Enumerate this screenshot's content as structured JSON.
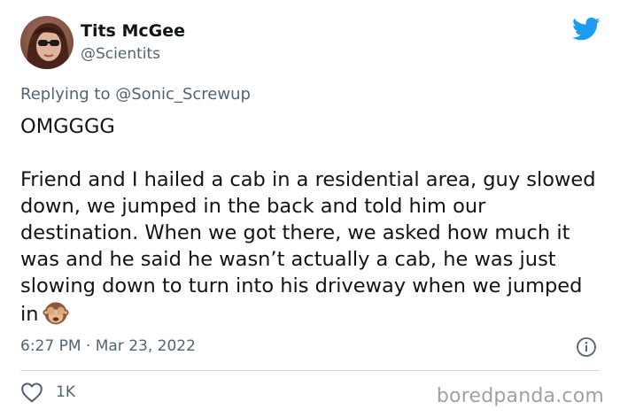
{
  "author": {
    "display_name": "Tits McGee",
    "handle": "@Scientits",
    "avatar_icon": "profile-photo-avatar"
  },
  "brand": {
    "icon": "twitter-bird-icon",
    "color": "#1d9bf0"
  },
  "reply": {
    "prefix": "Replying to ",
    "mention": "@Sonic_Screwup"
  },
  "tweet": {
    "line1": "OMGGGG",
    "line2": "Friend and I hailed a cab in a residential area, guy slowed down, we jumped in the back and told him our destination. When we got there, we asked how much it was and he said he wasn’t actually a cab, he was just slowing down to turn into his driveway when we jumped in",
    "emoji": "see-no-evil-monkey-emoji"
  },
  "meta": {
    "timestamp": "6:27 PM · Mar 23, 2022",
    "info_icon": "info-circle-icon"
  },
  "actions": {
    "like_icon": "heart-outline-icon",
    "like_count": "1K"
  },
  "watermark": {
    "text": "boredpanda.com"
  },
  "colors": {
    "text_primary": "#0f1419",
    "text_secondary": "#536471",
    "divider": "#cfd9de",
    "watermark": "#9aa3ab"
  }
}
